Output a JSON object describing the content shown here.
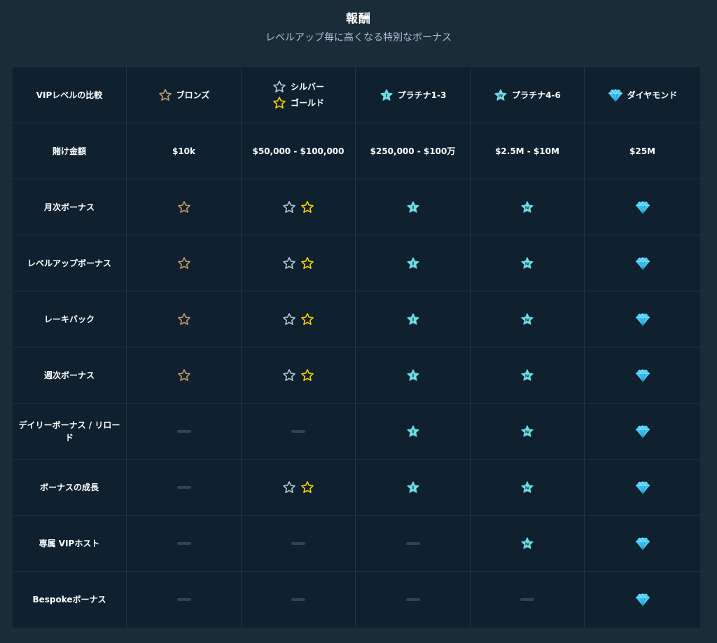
{
  "header": {
    "title": "報酬",
    "subtitle": "レベルアップ毎に高くなる特別なボーナス"
  },
  "colors": {
    "bronze": "#c69c6d",
    "silver": "#b2ccd9",
    "gold": "#fed100",
    "platinum": "#6fdde7",
    "diamond": "#3ec6f3",
    "dash": "#2f4553"
  },
  "table": {
    "corner_label": "VIPレベルの比較",
    "tiers": [
      {
        "id": "bronze",
        "label": "ブロンズ",
        "icon": "bronze-star-icon"
      },
      {
        "id": "silver_gold",
        "silver_label": "シルバー",
        "gold_label": "ゴールド",
        "icon": "silver-gold-star-icon"
      },
      {
        "id": "plat13",
        "label": "プラチナ1-3",
        "icon": "platinum-i-star-icon"
      },
      {
        "id": "plat46",
        "label": "プラチナ4-6",
        "icon": "platinum-iv-star-icon"
      },
      {
        "id": "diamond",
        "label": "ダイヤモンド",
        "icon": "diamond-icon"
      }
    ],
    "wager": {
      "label": "賭け金額",
      "values": [
        "$10k",
        "$50,000 - $100,000",
        "$250,000 - $100万",
        "$2.5M - $10M",
        "$25M"
      ]
    },
    "benefits": [
      {
        "label": "月次ボーナス",
        "available": [
          true,
          true,
          true,
          true,
          true
        ]
      },
      {
        "label": "レベルアップボーナス",
        "available": [
          true,
          true,
          true,
          true,
          true
        ]
      },
      {
        "label": "レーキバック",
        "available": [
          true,
          true,
          true,
          true,
          true
        ]
      },
      {
        "label": "週次ボーナス",
        "available": [
          true,
          true,
          true,
          true,
          true
        ]
      },
      {
        "label": "デイリーボーナス / リロード",
        "available": [
          false,
          false,
          true,
          true,
          true
        ]
      },
      {
        "label": "ボーナスの成長",
        "available": [
          false,
          true,
          true,
          true,
          true
        ]
      },
      {
        "label": "専属 VIPホスト",
        "available": [
          false,
          false,
          false,
          true,
          true
        ]
      },
      {
        "label": "Bespokeボーナス",
        "available": [
          false,
          false,
          false,
          false,
          true
        ]
      }
    ]
  }
}
